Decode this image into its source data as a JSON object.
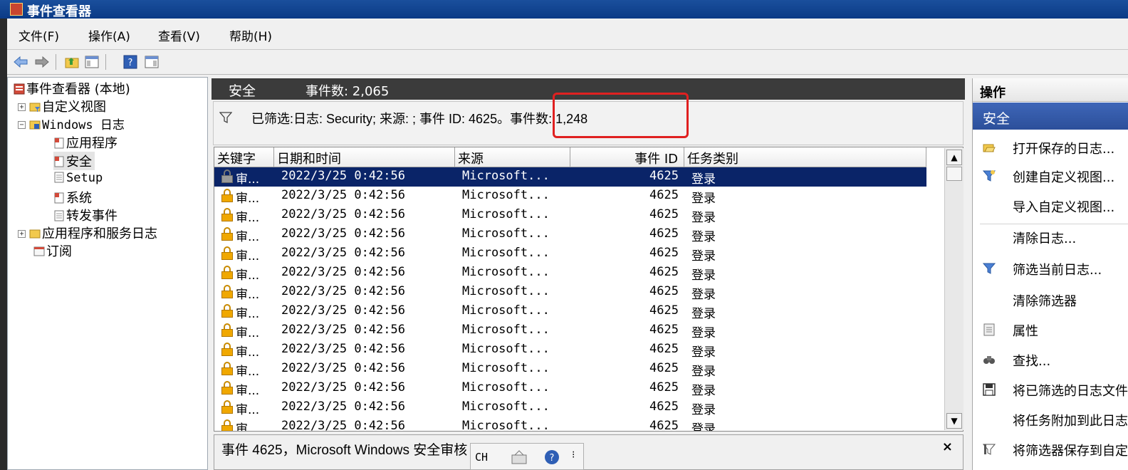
{
  "window": {
    "title": "事件查看器"
  },
  "menu": [
    "文件(F)",
    "操作(A)",
    "查看(V)",
    "帮助(H)"
  ],
  "tree": {
    "root": "事件查看器 (本地)",
    "custom_views": "自定义视图",
    "windows_logs": "Windows 日志",
    "application": "应用程序",
    "security": "安全",
    "setup": "Setup",
    "system": "系统",
    "forwarded": "转发事件",
    "app_service_logs": "应用程序和服务日志",
    "subscriptions": "订阅"
  },
  "center": {
    "log_name": "安全",
    "event_count": "事件数: 2,065",
    "filter_text": "已筛选:日志: Security; 来源: ; 事件 ID: 4625。事件数: 1,248"
  },
  "table": {
    "headers": [
      "关键字",
      "日期和时间",
      "来源",
      "事件 ID",
      "任务类别"
    ],
    "rows": [
      {
        "keyword": "审...",
        "datetime": "2022/3/25 0:42:56",
        "source": "Microsoft...",
        "event_id": "4625",
        "category": "登录"
      },
      {
        "keyword": "审...",
        "datetime": "2022/3/25 0:42:56",
        "source": "Microsoft...",
        "event_id": "4625",
        "category": "登录"
      },
      {
        "keyword": "审...",
        "datetime": "2022/3/25 0:42:56",
        "source": "Microsoft...",
        "event_id": "4625",
        "category": "登录"
      },
      {
        "keyword": "审...",
        "datetime": "2022/3/25 0:42:56",
        "source": "Microsoft...",
        "event_id": "4625",
        "category": "登录"
      },
      {
        "keyword": "审...",
        "datetime": "2022/3/25 0:42:56",
        "source": "Microsoft...",
        "event_id": "4625",
        "category": "登录"
      },
      {
        "keyword": "审...",
        "datetime": "2022/3/25 0:42:56",
        "source": "Microsoft...",
        "event_id": "4625",
        "category": "登录"
      },
      {
        "keyword": "审...",
        "datetime": "2022/3/25 0:42:56",
        "source": "Microsoft...",
        "event_id": "4625",
        "category": "登录"
      },
      {
        "keyword": "审...",
        "datetime": "2022/3/25 0:42:56",
        "source": "Microsoft...",
        "event_id": "4625",
        "category": "登录"
      },
      {
        "keyword": "审...",
        "datetime": "2022/3/25 0:42:56",
        "source": "Microsoft...",
        "event_id": "4625",
        "category": "登录"
      },
      {
        "keyword": "审...",
        "datetime": "2022/3/25 0:42:56",
        "source": "Microsoft...",
        "event_id": "4625",
        "category": "登录"
      },
      {
        "keyword": "审...",
        "datetime": "2022/3/25 0:42:56",
        "source": "Microsoft...",
        "event_id": "4625",
        "category": "登录"
      },
      {
        "keyword": "审...",
        "datetime": "2022/3/25 0:42:56",
        "source": "Microsoft...",
        "event_id": "4625",
        "category": "登录"
      },
      {
        "keyword": "审...",
        "datetime": "2022/3/25 0:42:56",
        "source": "Microsoft...",
        "event_id": "4625",
        "category": "登录"
      },
      {
        "keyword": "审...",
        "datetime": "2022/3/25 0:42:56",
        "source": "Microsoft...",
        "event_id": "4625",
        "category": "登录"
      }
    ]
  },
  "detail": {
    "text": "事件 4625，Microsoft Windows 安全审核",
    "close": "×"
  },
  "ime": {
    "label": "CH"
  },
  "actions": {
    "header": "操作",
    "section": "安全",
    "items": [
      {
        "label": "打开保存的日志...",
        "icon": "folder-open-icon"
      },
      {
        "label": "创建自定义视图...",
        "icon": "filter-create-icon"
      },
      {
        "label": "导入自定义视图...",
        "icon": ""
      },
      {
        "label": "清除日志...",
        "icon": ""
      },
      {
        "label": "筛选当前日志...",
        "icon": "filter-icon"
      },
      {
        "label": "清除筛选器",
        "icon": ""
      },
      {
        "label": "属性",
        "icon": "properties-icon"
      },
      {
        "label": "查找...",
        "icon": "binoculars-icon"
      },
      {
        "label": "将已筛选的日志文件另存为...",
        "icon": "save-icon"
      },
      {
        "label": "将任务附加到此日志...",
        "icon": ""
      },
      {
        "label": "将筛选器保存到自定义视图...",
        "icon": "filter-save-icon"
      }
    ]
  },
  "colors": {
    "selection": "#0a2468",
    "highlight_box": "#e02020",
    "title_bar": "#0b3a86"
  }
}
